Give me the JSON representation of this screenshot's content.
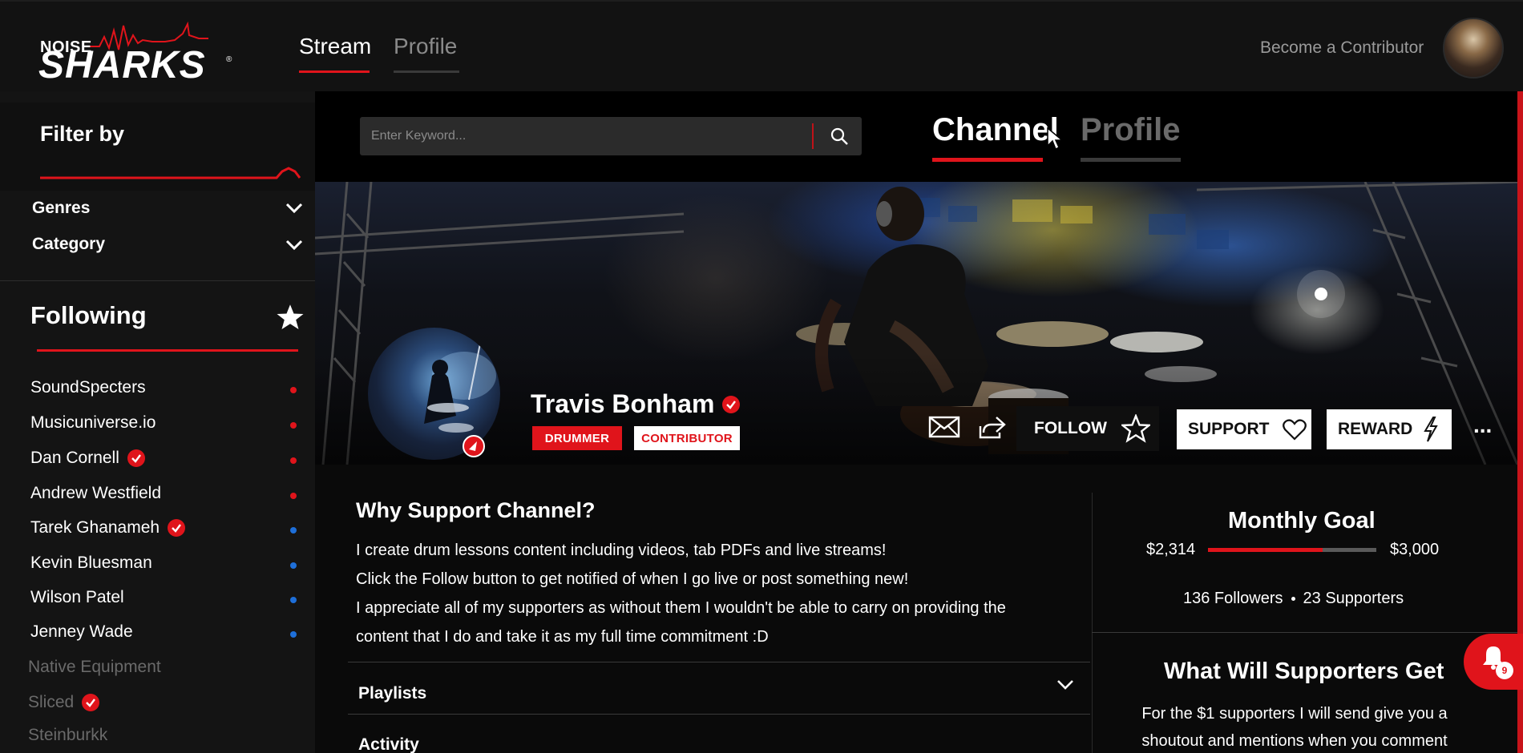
{
  "header": {
    "logo_small": "NOISE",
    "logo_big": "SHARKS",
    "logo_mark": "®",
    "tabs": [
      {
        "label": "Stream",
        "active": true
      },
      {
        "label": "Profile",
        "active": false
      }
    ],
    "become_contributor": "Become a Contributor",
    "avatar_icon": "user-avatar"
  },
  "sidebar": {
    "filter_title": "Filter by",
    "dropdowns": [
      {
        "label": "Genres",
        "icon": "chevron-down-icon"
      },
      {
        "label": "Category",
        "icon": "chevron-down-icon"
      }
    ],
    "following_title": "Following",
    "following_icon": "star-icon",
    "following": [
      {
        "name": "SoundSpecters",
        "verified": false,
        "status": "red",
        "dim": false
      },
      {
        "name": "Musicuniverse.io",
        "verified": false,
        "status": "red",
        "dim": false
      },
      {
        "name": "Dan Cornell",
        "verified": true,
        "status": "red",
        "dim": false
      },
      {
        "name": "Andrew Westfield",
        "verified": false,
        "status": "red",
        "dim": false
      },
      {
        "name": "Tarek Ghanameh",
        "verified": true,
        "status": "blue",
        "dim": false
      },
      {
        "name": "Kevin Bluesman",
        "verified": false,
        "status": "blue",
        "dim": false
      },
      {
        "name": "Wilson Patel",
        "verified": false,
        "status": "blue",
        "dim": false
      },
      {
        "name": "Jenney Wade",
        "verified": false,
        "status": "blue",
        "dim": false
      },
      {
        "name": "Native Equipment",
        "verified": false,
        "status": "none",
        "dim": true
      },
      {
        "name": "Sliced",
        "verified": true,
        "status": "none",
        "dim": true
      },
      {
        "name": "Steinburkk",
        "verified": false,
        "status": "none",
        "dim": true
      }
    ]
  },
  "search": {
    "placeholder": "Enter Keyword...",
    "icon": "search-icon"
  },
  "channel_tabs": [
    {
      "label": "Channel",
      "active": true
    },
    {
      "label": "Profile",
      "active": false
    }
  ],
  "channel": {
    "name": "Travis Bonham",
    "verified": true,
    "tags": [
      "DRUMMER",
      "CONTRIBUTOR"
    ],
    "actions": {
      "message_icon": "envelope-icon",
      "share_icon": "share-icon",
      "follow_label": "FOLLOW",
      "follow_icon": "star-outline-icon",
      "support_label": "SUPPORT",
      "support_icon": "heart-icon",
      "reward_label": "REWARD",
      "reward_icon": "lightning-icon",
      "more_label": "..."
    }
  },
  "about": {
    "title": "Why Support Channel?",
    "lines": [
      "I create drum lessons content including videos, tab PDFs and live streams!",
      "Click the Follow button to get notified of when I go live or post something new!",
      "I appreciate all of my supporters as without them I wouldn't be able to carry on providing the",
      "content that I do and take it as my full time commitment :D"
    ],
    "sections": [
      "Playlists",
      "Activity"
    ]
  },
  "goal": {
    "title": "Monthly Goal",
    "current": "$2,314",
    "target": "$3,000",
    "progress": 0.68,
    "followers": "136 Followers",
    "supporters": "23 Supporters"
  },
  "supporters_get": {
    "title": "What Will Supporters Get",
    "lines": [
      "For the $1 supporters I will send give you a",
      "shoutout and mentions when you comment"
    ]
  },
  "notifications": {
    "count": "9",
    "icon": "bell-icon"
  },
  "colors": {
    "accent": "#e0141b",
    "live_red": "#e0141b",
    "live_blue": "#1e6fd9",
    "background": "#0a0a0a"
  }
}
